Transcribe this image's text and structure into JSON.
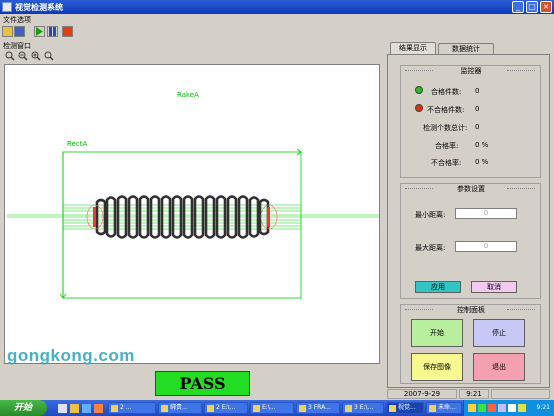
{
  "window": {
    "title": "视觉检测系统"
  },
  "menu": {
    "file": "文件选项"
  },
  "detection": {
    "title": "检测窗口",
    "rake_label": "RakeA",
    "rect_label": "RectA"
  },
  "result": {
    "text": "PASS"
  },
  "watermark": "gongkong.com",
  "tabs": {
    "results": "结果显示",
    "stats": "数据统计"
  },
  "monitor": {
    "title": "监控器",
    "pass_label": "合格件数:",
    "pass_value": "0",
    "fail_label": "不合格件数:",
    "fail_value": "0",
    "total_label": "检测个数总计:",
    "total_value": "0",
    "pass_rate_label": "合格率:",
    "pass_rate_value": "0 %",
    "fail_rate_label": "不合格率:",
    "fail_rate_value": "0 %"
  },
  "params": {
    "title": "参数设置",
    "min_label": "最小距离:",
    "min_value": "0",
    "max_label": "最大距离:",
    "max_value": "0",
    "apply": "应用",
    "cancel": "取消"
  },
  "control": {
    "title": "控制面板",
    "start": "开始",
    "stop": "停止",
    "save": "保存图像",
    "exit": "退出"
  },
  "status": {
    "date": "2007-9-29",
    "time": "9:21"
  },
  "taskbar": {
    "start": "开始",
    "tasks": [
      "2 ...",
      "绑贵...",
      "2 E:\\...",
      "E:\\...",
      "3 FRA...",
      "3 E:\\...",
      "视觉...",
      "未命..."
    ],
    "clock": "9:21"
  },
  "colors": {
    "green_led": "#22c022",
    "red_led": "#e03010",
    "apply_btn": "#33c4c4",
    "cancel_btn": "#f4c8f0",
    "start_btn": "#b8f0a0",
    "stop_btn": "#c8c8f4",
    "save_btn": "#f8f890",
    "exit_btn": "#f4a0b0",
    "pass_bg": "#22dd22"
  }
}
